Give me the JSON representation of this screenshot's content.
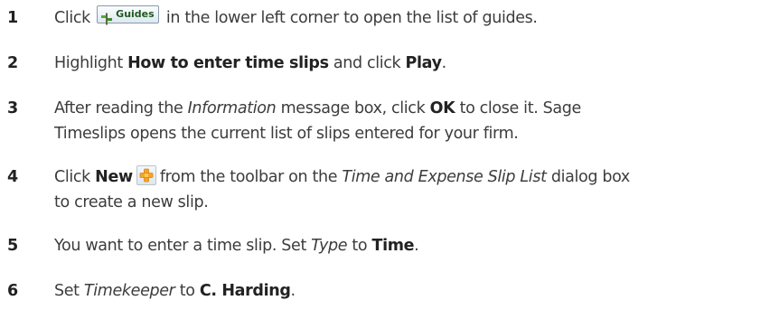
{
  "steps": [
    {
      "number": "1",
      "pre": "Click",
      "button_label": "Guides",
      "post": "in the lower left corner to open the list of guides."
    },
    {
      "number": "2",
      "pre": "Highlight",
      "bold1": "How to enter time slips",
      "mid": "and click",
      "bold2": "Play",
      "end": "."
    },
    {
      "number": "3",
      "pre": "After reading the",
      "ital1": "Information",
      "mid": "message box, click",
      "bold1": "OK",
      "post": "to close it. Sage",
      "line2": "Timeslips opens the current list of slips entered for your firm."
    },
    {
      "number": "4",
      "pre": "Click",
      "bold1": "New",
      "mid": "from the toolbar on the",
      "ital1": "Time and Expense Slip List",
      "post": "dialog box",
      "line2": "to create a new slip."
    },
    {
      "number": "5",
      "pre": "You want to enter a time slip. Set",
      "ital1": "Type",
      "mid": "to",
      "bold1": "Time",
      "end": "."
    },
    {
      "number": "6",
      "pre": "Set",
      "ital1": "Timekeeper",
      "mid": "to",
      "bold1": "C. Harding",
      "end": "."
    }
  ],
  "icons": {
    "guides": "guides-icon",
    "new": "plus-icon"
  },
  "colors": {
    "text": "#3c3c3c",
    "bold_text": "#222222",
    "guides_label": "#1d5a1d",
    "plus_orange": "#f5a623"
  }
}
